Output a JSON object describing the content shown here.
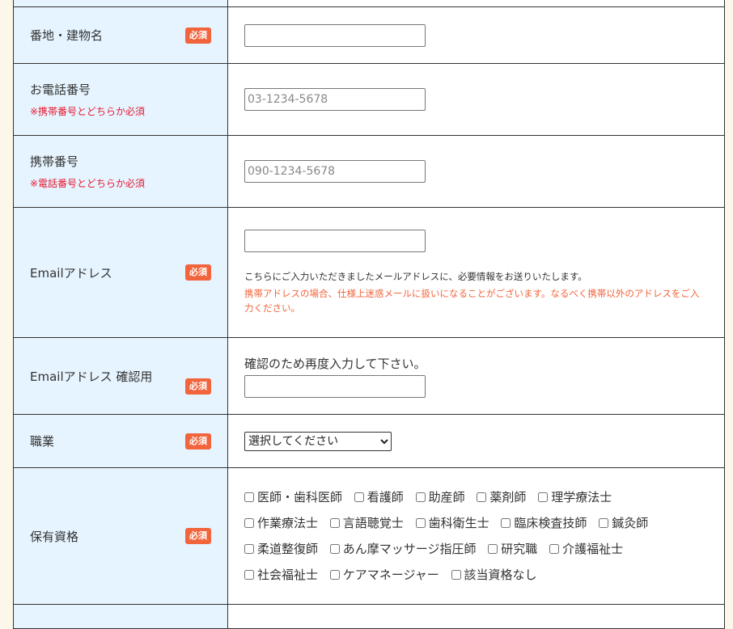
{
  "required_badge": "必須",
  "rows": {
    "address": {
      "label": "番地・建物名",
      "value": ""
    },
    "phone": {
      "label": "お電話番号",
      "note": "※携帯番号とどちらか必須",
      "placeholder": "03-1234-5678"
    },
    "mobile": {
      "label": "携帯番号",
      "note": "※電話番号とどちらか必須",
      "placeholder": "090-1234-5678"
    },
    "email": {
      "label": "Emailアドレス",
      "value": "",
      "help": "こちらにご入力いただきましたメールアドレスに、必要情報をお送りいたします。",
      "warning": "携帯アドレスの場合、仕様上迷惑メールに扱いになることがございます。なるべく携帯以外のアドレスをご入力ください。"
    },
    "email_confirm": {
      "label": "Emailアドレス 確認用",
      "note": "確認のため再度入力して下さい。",
      "value": ""
    },
    "occupation": {
      "label": "職業",
      "selected": "選択してください"
    },
    "qualifications": {
      "label": "保有資格",
      "options": [
        "医師・歯科医師",
        "看護師",
        "助産師",
        "薬剤師",
        "理学療法士",
        "作業療法士",
        "言語聴覚士",
        "歯科衛生士",
        "臨床検査技師",
        "鍼灸師",
        "柔道整復師",
        "あん摩マッサージ指圧師",
        "研究職",
        "介護福祉士",
        "社会福祉士",
        "ケアマネージャー",
        "該当資格なし"
      ]
    }
  }
}
